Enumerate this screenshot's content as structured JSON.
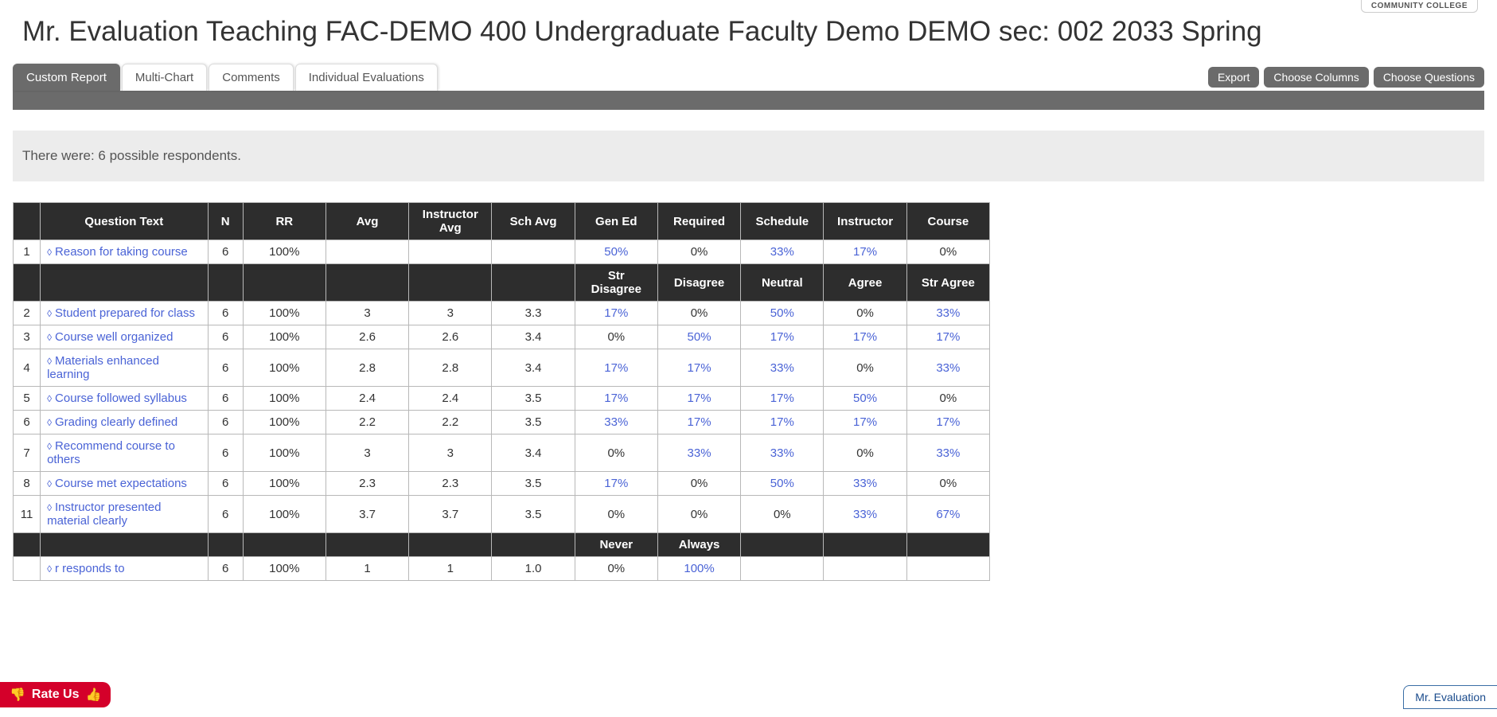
{
  "badge": "COMMUNITY COLLEGE",
  "page_title": "Mr. Evaluation Teaching FAC-DEMO 400 Undergraduate Faculty Demo DEMO sec: 002 2033 Spring",
  "tabs": [
    "Custom Report",
    "Multi-Chart",
    "Comments",
    "Individual Evaluations"
  ],
  "active_tab": 0,
  "buttons": {
    "export": "Export",
    "columns": "Choose Columns",
    "questions": "Choose Questions"
  },
  "banner": "There were: 6 possible respondents.",
  "headers": [
    "",
    "Question Text",
    "N",
    "RR",
    "Avg",
    "Instructor Avg",
    "Sch Avg"
  ],
  "group1_dist": [
    "Gen Ed",
    "Required",
    "Schedule",
    "Instructor",
    "Course"
  ],
  "group2_dist": [
    "Str Disagree",
    "Disagree",
    "Neutral",
    "Agree",
    "Str Agree"
  ],
  "group3_dist": [
    "Never",
    "Always"
  ],
  "rows_g1": [
    {
      "num": "1",
      "q": "Reason for taking course",
      "n": "6",
      "rr": "100%",
      "avg": "",
      "iavg": "",
      "savg": "",
      "d": [
        "50%",
        "0%",
        "33%",
        "17%",
        "0%"
      ],
      "links": [
        true,
        false,
        true,
        true,
        false
      ]
    }
  ],
  "rows_g2": [
    {
      "num": "2",
      "q": "Student prepared for class",
      "n": "6",
      "rr": "100%",
      "avg": "3",
      "iavg": "3",
      "savg": "3.3",
      "d": [
        "17%",
        "0%",
        "50%",
        "0%",
        "33%"
      ],
      "links": [
        true,
        false,
        true,
        false,
        true
      ]
    },
    {
      "num": "3",
      "q": "Course well organized",
      "n": "6",
      "rr": "100%",
      "avg": "2.6",
      "iavg": "2.6",
      "savg": "3.4",
      "d": [
        "0%",
        "50%",
        "17%",
        "17%",
        "17%"
      ],
      "links": [
        false,
        true,
        true,
        true,
        true
      ]
    },
    {
      "num": "4",
      "q": "Materials enhanced learning",
      "n": "6",
      "rr": "100%",
      "avg": "2.8",
      "iavg": "2.8",
      "savg": "3.4",
      "d": [
        "17%",
        "17%",
        "33%",
        "0%",
        "33%"
      ],
      "links": [
        true,
        true,
        true,
        false,
        true
      ]
    },
    {
      "num": "5",
      "q": "Course followed syllabus",
      "n": "6",
      "rr": "100%",
      "avg": "2.4",
      "iavg": "2.4",
      "savg": "3.5",
      "d": [
        "17%",
        "17%",
        "17%",
        "50%",
        "0%"
      ],
      "links": [
        true,
        true,
        true,
        true,
        false
      ]
    },
    {
      "num": "6",
      "q": "Grading clearly defined",
      "n": "6",
      "rr": "100%",
      "avg": "2.2",
      "iavg": "2.2",
      "savg": "3.5",
      "d": [
        "33%",
        "17%",
        "17%",
        "17%",
        "17%"
      ],
      "links": [
        true,
        true,
        true,
        true,
        true
      ]
    },
    {
      "num": "7",
      "q": "Recommend course to others",
      "n": "6",
      "rr": "100%",
      "avg": "3",
      "iavg": "3",
      "savg": "3.4",
      "d": [
        "0%",
        "33%",
        "33%",
        "0%",
        "33%"
      ],
      "links": [
        false,
        true,
        true,
        false,
        true
      ]
    },
    {
      "num": "8",
      "q": "Course met expectations",
      "n": "6",
      "rr": "100%",
      "avg": "2.3",
      "iavg": "2.3",
      "savg": "3.5",
      "d": [
        "17%",
        "0%",
        "50%",
        "33%",
        "0%"
      ],
      "links": [
        true,
        false,
        true,
        true,
        false
      ]
    },
    {
      "num": "11",
      "q": "Instructor presented material clearly",
      "n": "6",
      "rr": "100%",
      "avg": "3.7",
      "iavg": "3.7",
      "savg": "3.5",
      "d": [
        "0%",
        "0%",
        "0%",
        "33%",
        "67%"
      ],
      "links": [
        false,
        false,
        false,
        true,
        true
      ]
    }
  ],
  "rows_g3": [
    {
      "num": "",
      "q": "r responds to",
      "n": "6",
      "rr": "100%",
      "avg": "1",
      "iavg": "1",
      "savg": "1.0",
      "d": [
        "0%",
        "100%"
      ],
      "links": [
        false,
        true
      ]
    }
  ],
  "rate_us": "Rate Us",
  "footer_chip": "Mr. Evaluation"
}
